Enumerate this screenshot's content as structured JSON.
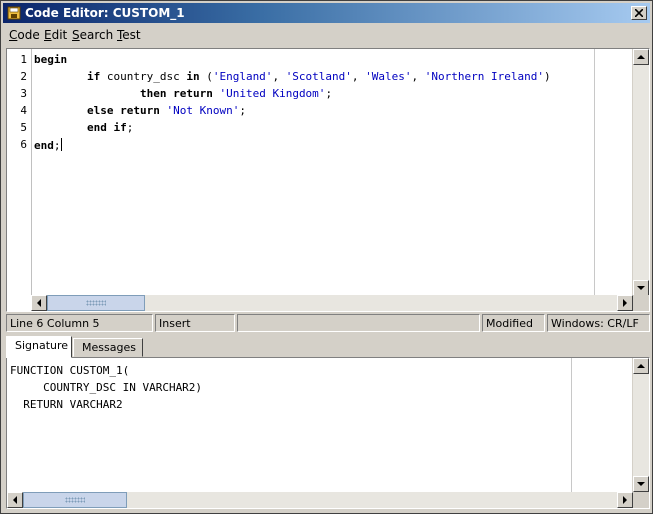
{
  "window": {
    "title": "Code Editor: CUSTOM_1"
  },
  "menu": [
    {
      "label": "Code",
      "mnemonic": "C",
      "rest": "ode"
    },
    {
      "label": "Edit",
      "mnemonic": "E",
      "rest": "dit"
    },
    {
      "label": "Search",
      "mnemonic": "S",
      "rest": "earch"
    },
    {
      "label": "Test",
      "mnemonic": "T",
      "rest": "est"
    }
  ],
  "editor": {
    "line_numbers": [
      "1",
      "2",
      "3",
      "4",
      "5",
      "6"
    ],
    "lines": [
      [
        {
          "t": "kw",
          "v": "begin"
        }
      ],
      [
        {
          "t": "pl",
          "v": "        "
        },
        {
          "t": "kw",
          "v": "if"
        },
        {
          "t": "pl",
          "v": " country_dsc "
        },
        {
          "t": "kw",
          "v": "in"
        },
        {
          "t": "pl",
          "v": " ("
        },
        {
          "t": "str",
          "v": "'England'"
        },
        {
          "t": "pl",
          "v": ", "
        },
        {
          "t": "str",
          "v": "'Scotland'"
        },
        {
          "t": "pl",
          "v": ", "
        },
        {
          "t": "str",
          "v": "'Wales'"
        },
        {
          "t": "pl",
          "v": ", "
        },
        {
          "t": "str",
          "v": "'Northern Ireland'"
        },
        {
          "t": "pl",
          "v": ")"
        }
      ],
      [
        {
          "t": "pl",
          "v": "                "
        },
        {
          "t": "kw",
          "v": "then"
        },
        {
          "t": "pl",
          "v": " "
        },
        {
          "t": "kw",
          "v": "return"
        },
        {
          "t": "pl",
          "v": " "
        },
        {
          "t": "str",
          "v": "'United Kingdom'"
        },
        {
          "t": "pl",
          "v": ";"
        }
      ],
      [
        {
          "t": "pl",
          "v": "        "
        },
        {
          "t": "kw",
          "v": "else"
        },
        {
          "t": "pl",
          "v": " "
        },
        {
          "t": "kw",
          "v": "return"
        },
        {
          "t": "pl",
          "v": " "
        },
        {
          "t": "str",
          "v": "'Not Known'"
        },
        {
          "t": "pl",
          "v": ";"
        }
      ],
      [
        {
          "t": "pl",
          "v": "        "
        },
        {
          "t": "kw",
          "v": "end if"
        },
        {
          "t": "pl",
          "v": ";"
        }
      ],
      [
        {
          "t": "kw",
          "v": "end"
        },
        {
          "t": "pl",
          "v": ";"
        }
      ]
    ]
  },
  "status": {
    "position": "Line 6 Column 5",
    "mode": "Insert",
    "message": "",
    "modified": "Modified",
    "line_ending": "Windows: CR/LF"
  },
  "tabs": [
    {
      "label": "Signature",
      "active": true
    },
    {
      "label": "Messages",
      "active": false
    }
  ],
  "signature": {
    "lines": [
      "FUNCTION CUSTOM_1(",
      "     COUNTRY_DSC IN VARCHAR2)",
      "  RETURN VARCHAR2"
    ]
  },
  "colors": {
    "title_gradient_start": "#0a246a",
    "title_gradient_end": "#a6caf0",
    "string_literal": "#0000c0",
    "chrome": "#d4d0c8"
  },
  "icons": {
    "window": "editor-window-icon",
    "close": "close-icon"
  }
}
